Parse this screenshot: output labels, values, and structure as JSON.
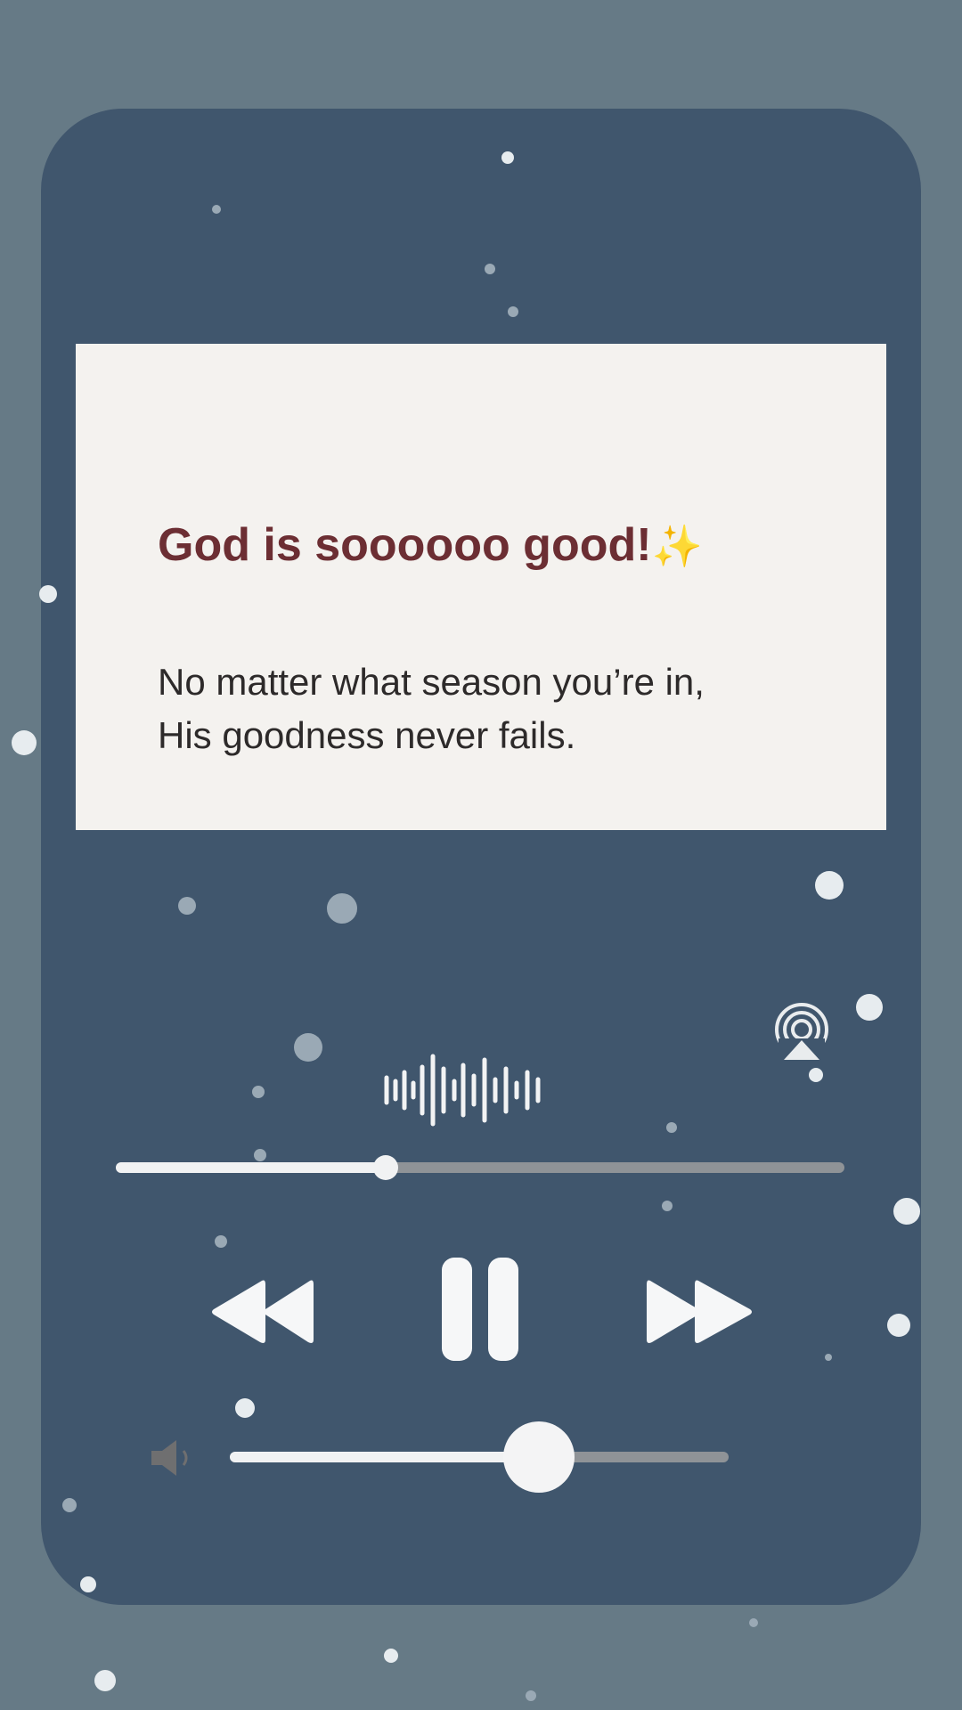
{
  "quote": {
    "title": "God is soooooo good!",
    "title_emoji": "✨",
    "body_line1": "No matter what season you’re in,",
    "body_line2": "His goodness never fails."
  },
  "player": {
    "progress_fraction": 0.37,
    "volume_fraction": 0.62,
    "icons": {
      "airplay": "airplay-icon",
      "waveform": "waveform-icon",
      "rewind": "rewind-icon",
      "pause": "pause-icon",
      "forward": "fast-forward-icon",
      "volume": "volume-icon"
    }
  },
  "colors": {
    "background": "#667a86",
    "card": "#40566d",
    "quote_bg": "#f4f2ef",
    "title": "#6c2e33",
    "accent": "#f1f2f3"
  }
}
